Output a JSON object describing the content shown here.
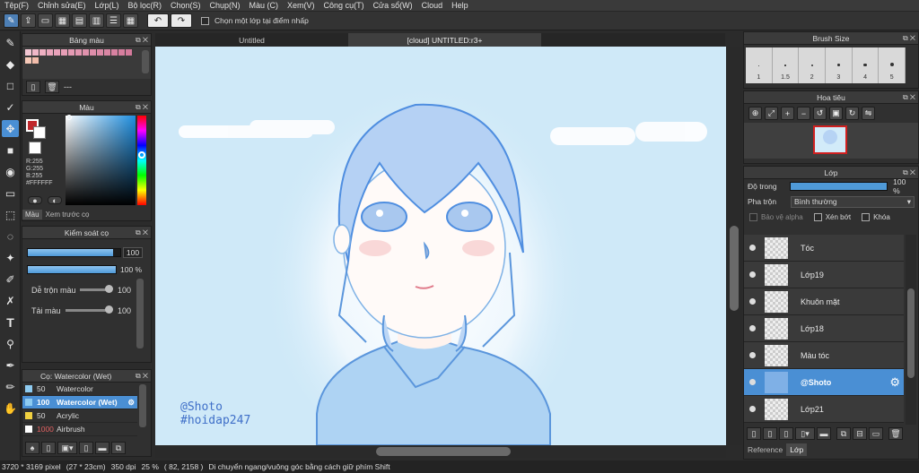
{
  "menu": [
    "Tệp(F)",
    "Chỉnh sửa(E)",
    "Lớp(L)",
    "Bộ lọc(R)",
    "Chọn(S)",
    "Chụp(N)",
    "Màu (C)",
    "Xem(V)",
    "Công cụ(T)",
    "Cửa sổ(W)",
    "Cloud",
    "Help"
  ],
  "toolbar": {
    "select_layer_label": "Chọn một lớp tại điểm nhấp"
  },
  "document_tabs": [
    "Untitled",
    "[cloud] UNTITLED:r3+"
  ],
  "palette_panel": {
    "title": "Bảng màu",
    "status": "---"
  },
  "color_panel": {
    "title": "Màu",
    "r": "R:255",
    "g": "G:255",
    "b": "B:255",
    "hex": "#FFFFFF",
    "tab_color": "Màu",
    "tab_preview": "Xem trước cọ"
  },
  "brush_control": {
    "title": "Kiểm soát cọ",
    "size_value": "100",
    "size_fill": 0.92,
    "opacity_value": "100 %",
    "opacity_fill": 1.0,
    "mix_label": "Dễ trộn màu",
    "mix_value": "100",
    "dip_label": "Tải màu",
    "dip_value": "100"
  },
  "brush_list": {
    "title": "Cọ: Watercolor (Wet)",
    "items": [
      {
        "size": "50",
        "name": "Watercolor",
        "color": "#8ecbf0",
        "selected": false
      },
      {
        "size": "100",
        "name": "Watercolor (Wet)",
        "color": "#8ecbf0",
        "selected": true
      },
      {
        "size": "50",
        "name": "Acrylic",
        "color": "#f0d040",
        "selected": false
      },
      {
        "size": "1000",
        "name": "Airbrush",
        "color": "#ffffff",
        "selected": false
      }
    ]
  },
  "canvas_text": {
    "line1": "@Shoto",
    "line2": "#hoidap247"
  },
  "brush_size_panel": {
    "title": "Brush Size",
    "sizes": [
      "1",
      "1.5",
      "2",
      "3",
      "4",
      "5"
    ]
  },
  "navigator": {
    "title": "Hoa tiêu"
  },
  "layer_panel": {
    "title": "Lớp",
    "opacity_label": "Độ trong",
    "opacity_value": "100 %",
    "blend_label": "Pha trộn",
    "blend_value": "Bình thường",
    "protect_alpha": "Bảo vệ alpha",
    "clipping": "Xén bớt",
    "lock": "Khóa",
    "layers": [
      {
        "name": "Tóc",
        "selected": false
      },
      {
        "name": "Lớp19",
        "selected": false
      },
      {
        "name": "Khuôn mặt",
        "selected": false
      },
      {
        "name": "Lớp18",
        "selected": false
      },
      {
        "name": "Màu tóc",
        "selected": false
      },
      {
        "name": "@Shoto",
        "selected": true
      },
      {
        "name": "Lớp21",
        "selected": false
      }
    ],
    "bottom_tabs": [
      "Reference",
      "Lớp"
    ]
  },
  "status": {
    "pixels": "3720 * 3169 pixel",
    "cm": "(27 * 23cm)",
    "dpi": "350 dpi",
    "zoom": "25 %",
    "coords": "( 82, 2158 )",
    "hint": "Di chuyển ngang/vuông góc bằng cách giữ phím Shift"
  },
  "colors": {
    "accent": "#4a8fd4",
    "canvas_bg": "#cfe9f8",
    "primary_color": "#c0282c",
    "secondary_color": "#ffffff"
  }
}
